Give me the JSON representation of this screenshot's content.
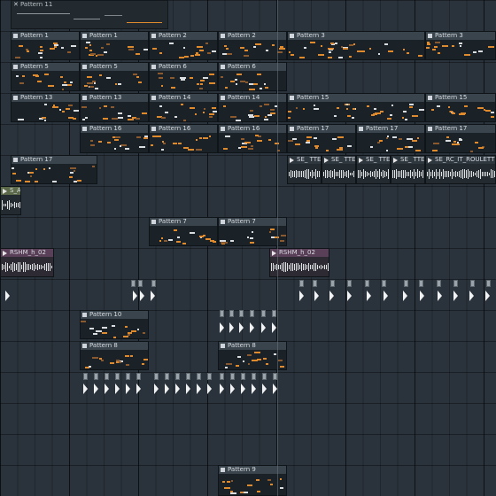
{
  "colors": {
    "note": "#e08a2e",
    "clip_header": "#3a444c",
    "audio_wave": "#dfe3e6"
  },
  "top_clip": {
    "label": "Pattern 11"
  },
  "clips": [
    {
      "label": "Pattern 1"
    },
    {
      "label": "Pattern 1"
    },
    {
      "label": "Pattern 2"
    },
    {
      "label": "Pattern 2"
    },
    {
      "label": "Pattern 3"
    },
    {
      "label": "Pattern 3"
    },
    {
      "label": "Pattern 5"
    },
    {
      "label": "Pattern 5"
    },
    {
      "label": "Pattern 6"
    },
    {
      "label": "Pattern 6"
    },
    {
      "label": "Pattern 13"
    },
    {
      "label": "Pattern 13"
    },
    {
      "label": "Pattern 14"
    },
    {
      "label": "Pattern 14"
    },
    {
      "label": "Pattern 15"
    },
    {
      "label": "Pattern 15"
    },
    {
      "label": "Pattern 16"
    },
    {
      "label": "Pattern 16"
    },
    {
      "label": "Pattern 16"
    },
    {
      "label": "Pattern 17"
    },
    {
      "label": "Pattern 17"
    },
    {
      "label": "Pattern 17"
    },
    {
      "label": "Pattern 17"
    },
    {
      "label": "SE_ TTE"
    },
    {
      "label": "SE_ TTE"
    },
    {
      "label": "SE_ TTE"
    },
    {
      "label": "SE_ TTE"
    },
    {
      "label": "SE_RC_IT_ROULETTE"
    },
    {
      "label": "S_AP"
    },
    {
      "label": "Pattern 7"
    },
    {
      "label": "Pattern 7"
    },
    {
      "label": "RSHM_h_02"
    },
    {
      "label": "RSHM_h_02"
    },
    {
      "label": "Pattern 10"
    },
    {
      "label": "Pattern 8"
    },
    {
      "label": "Pattern 8"
    },
    {
      "label": "Pattern 9"
    }
  ]
}
